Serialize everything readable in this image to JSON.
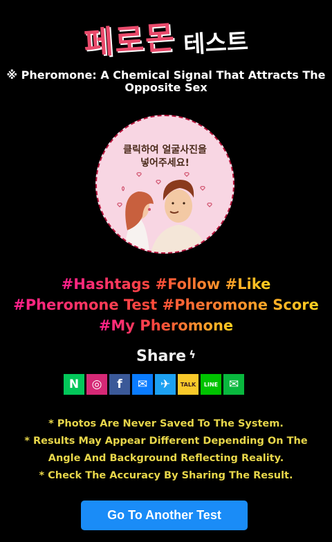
{
  "header": {
    "logo_main": "페로몬",
    "logo_sub": "테스트"
  },
  "subtitle": "※ Pheromone: A Chemical Signal That Attracts The Opposite Sex",
  "photo_upload": {
    "prompt_line1": "클릭하여 얼굴사진을",
    "prompt_line2": "넣어주세요!"
  },
  "hashtags": {
    "row1": "#Hashtags #Follow #Like",
    "row2": "#Pheromone Test #Pheromone Score",
    "row3": "#My Pheromone"
  },
  "share": {
    "label": "Share",
    "icons": [
      {
        "name": "naver",
        "glyph": "N",
        "color": "#03c75a"
      },
      {
        "name": "instagram",
        "glyph": "◎",
        "color": "#d62976"
      },
      {
        "name": "facebook",
        "glyph": "f",
        "color": "#3b5998"
      },
      {
        "name": "messenger",
        "glyph": "✉",
        "color": "#0a7cff"
      },
      {
        "name": "twitter",
        "glyph": "✈",
        "color": "#1da1f2"
      },
      {
        "name": "kakaotalk",
        "glyph": "TALK",
        "color": "#f9c92a"
      },
      {
        "name": "line",
        "glyph": "LINE",
        "color": "#00c300"
      },
      {
        "name": "wechat",
        "glyph": "✉",
        "color": "#09b83e"
      }
    ]
  },
  "notes": {
    "line1": "* Photos Are Never Saved To The System.",
    "line2": "* Results May Appear Different Depending On The",
    "line3": "Angle And Background Reflecting Reality.",
    "line4": "* Check The Accuracy By Sharing The Result."
  },
  "cta": {
    "label": "Go To Another Test"
  }
}
